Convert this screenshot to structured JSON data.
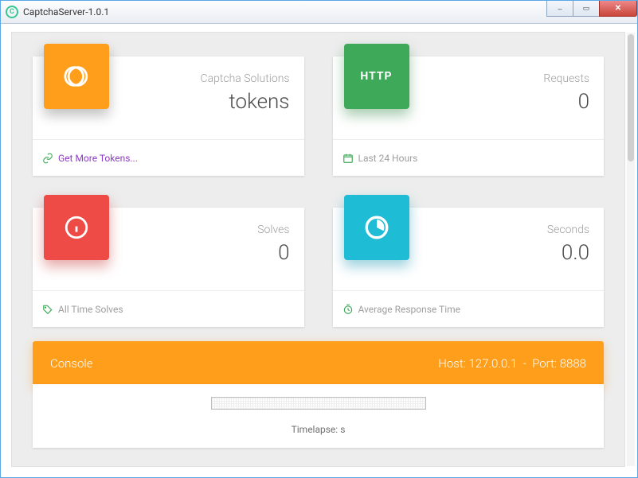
{
  "window": {
    "title": "CaptchaServer-1.0.1"
  },
  "cards": {
    "tokens": {
      "label": "Captcha Solutions",
      "value": "tokens",
      "footer_link": "Get More Tokens..."
    },
    "requests": {
      "label": "Requests",
      "value": "0",
      "footer_text": "Last 24 Hours"
    },
    "solves": {
      "label": "Solves",
      "value": "0",
      "footer_text": "All Time Solves"
    },
    "seconds": {
      "label": "Seconds",
      "value": "0.0",
      "footer_text": "Average Response Time"
    }
  },
  "tiles": {
    "http_label": "HTTP"
  },
  "console": {
    "title": "Console",
    "host_label": "Host:",
    "host": "127.0.0.1",
    "sep": "-",
    "port_label": "Port:",
    "port": "8888",
    "timelapse_label": "Timelapse:",
    "timelapse_unit": "s"
  }
}
